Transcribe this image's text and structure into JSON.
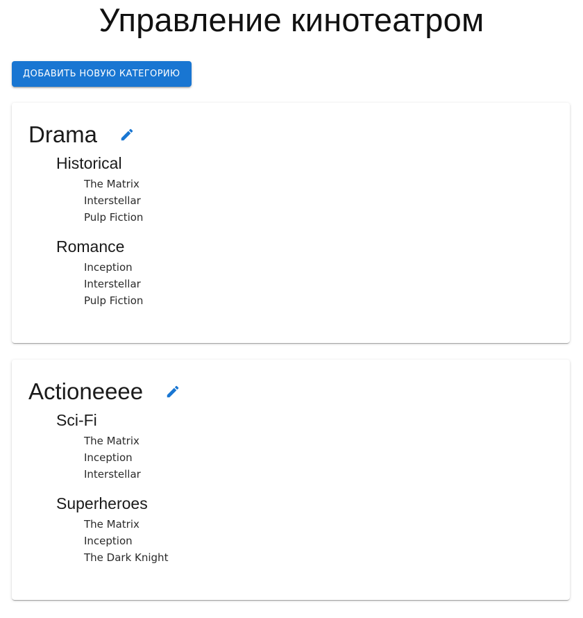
{
  "page": {
    "title": "Управление кинотеатром"
  },
  "toolbar": {
    "add_category_label": "ДОБАВИТЬ НОВУЮ КАТЕГОРИЮ"
  },
  "colors": {
    "accent": "#1976d2",
    "edit_icon": "#1976d2"
  },
  "categories": [
    {
      "name": "Drama",
      "edit_icon": "pencil-icon",
      "subcategories": [
        {
          "name": "Historical",
          "movies": [
            "The Matrix",
            "Interstellar",
            "Pulp Fiction"
          ]
        },
        {
          "name": "Romance",
          "movies": [
            "Inception",
            "Interstellar",
            "Pulp Fiction"
          ]
        }
      ]
    },
    {
      "name": "Actioneeee",
      "edit_icon": "pencil-icon",
      "subcategories": [
        {
          "name": "Sci-Fi",
          "movies": [
            "The Matrix",
            "Inception",
            "Interstellar"
          ]
        },
        {
          "name": "Superheroes",
          "movies": [
            "The Matrix",
            "Inception",
            "The Dark Knight"
          ]
        }
      ]
    }
  ]
}
